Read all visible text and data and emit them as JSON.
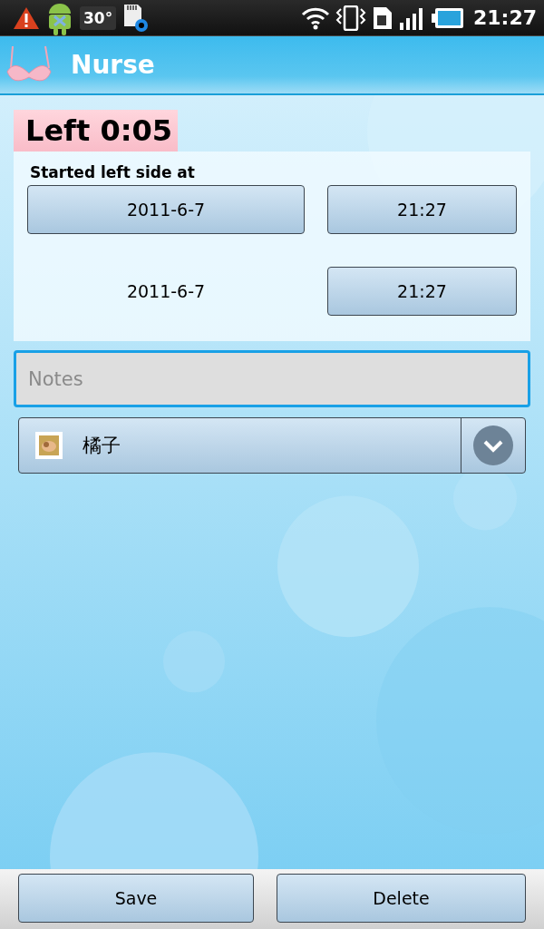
{
  "status_bar": {
    "temperature": "30°",
    "time": "21:27"
  },
  "app_bar": {
    "title": "Nurse"
  },
  "timer": {
    "label": "Left 0:05"
  },
  "session": {
    "caption": "Started left side at",
    "start": {
      "date": "2011-6-7",
      "time": "21:27"
    },
    "end": {
      "date": "2011-6-7",
      "time": "21:27"
    }
  },
  "notes": {
    "placeholder": "Notes",
    "focused": true
  },
  "baby_picker": {
    "value": "橘子"
  },
  "buttons": [
    "Save",
    "Delete"
  ]
}
